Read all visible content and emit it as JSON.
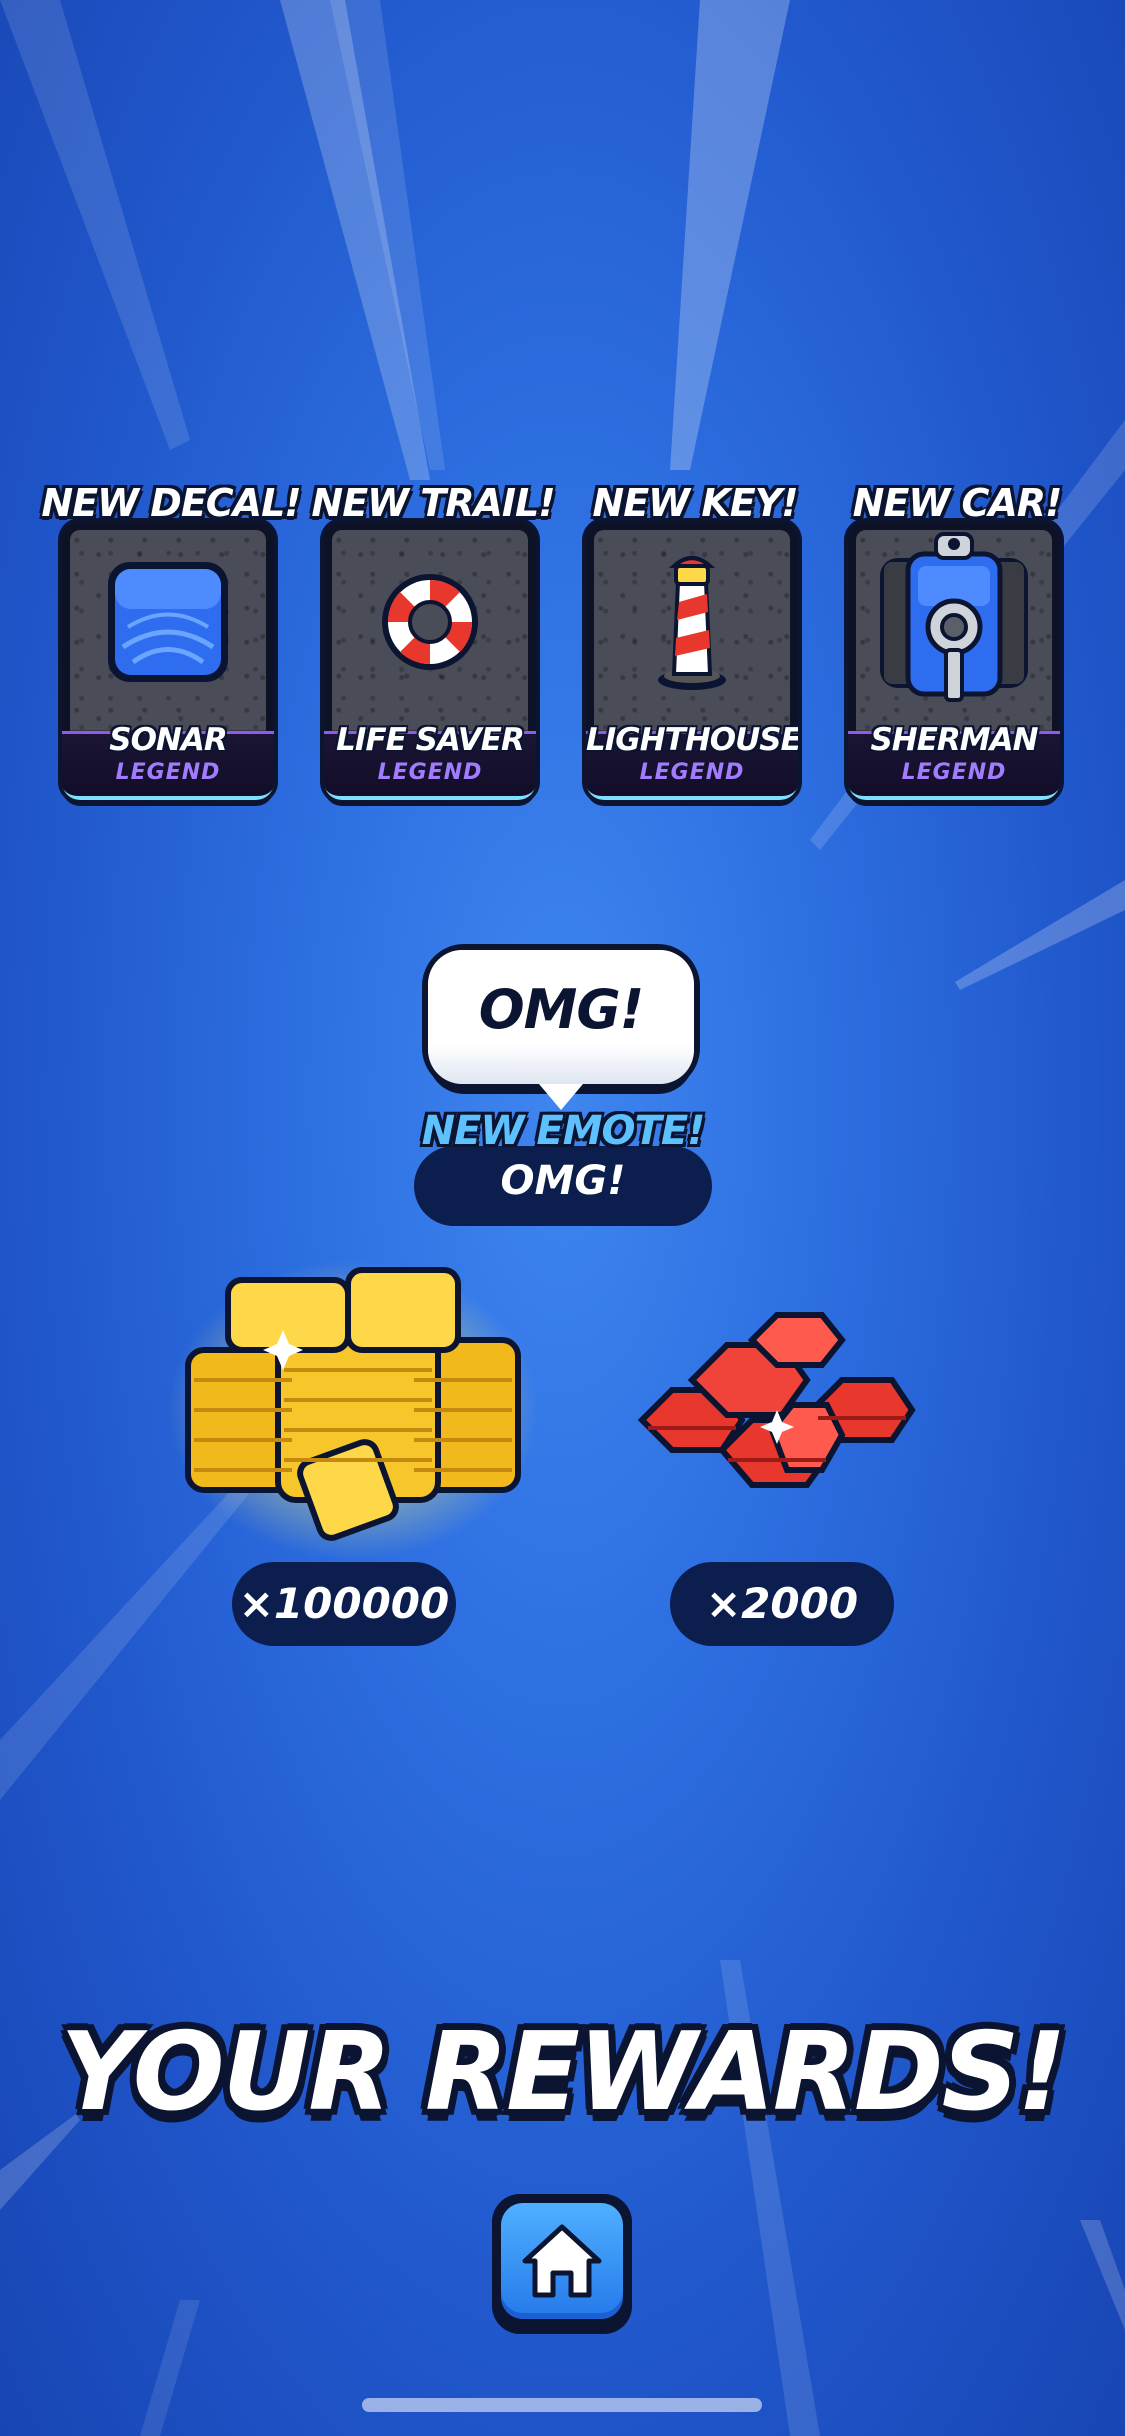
{
  "rewards": [
    {
      "header": "NEW DECAL!",
      "name": "SONAR",
      "rarity": "LEGEND",
      "icon": "sonar-decal-icon"
    },
    {
      "header": "NEW TRAIL!",
      "name": "LIFE SAVER",
      "rarity": "LEGEND",
      "icon": "life-saver-icon"
    },
    {
      "header": "NEW KEY!",
      "name": "LIGHTHOUSE",
      "rarity": "LEGEND",
      "icon": "lighthouse-key-icon"
    },
    {
      "header": "NEW CAR!",
      "name": "SHERMAN",
      "rarity": "LEGEND",
      "icon": "sherman-car-icon"
    }
  ],
  "emote": {
    "bubble_text": "OMG!",
    "kind_label": "NEW EMOTE!",
    "name": "OMG!"
  },
  "currency": {
    "coins": {
      "amount": "×100000",
      "icon": "gold-coins-pile-icon"
    },
    "gems": {
      "amount": "×2000",
      "icon": "red-gems-pile-icon"
    }
  },
  "title": "YOUR REWARDS!",
  "home_button": {
    "icon": "home-icon"
  },
  "colors": {
    "background": "#2c6de0",
    "outline": "#0b1431",
    "legend_purple": "#a27cff",
    "emote_blue": "#5ec1ff",
    "button_blue": "#2579ea"
  }
}
